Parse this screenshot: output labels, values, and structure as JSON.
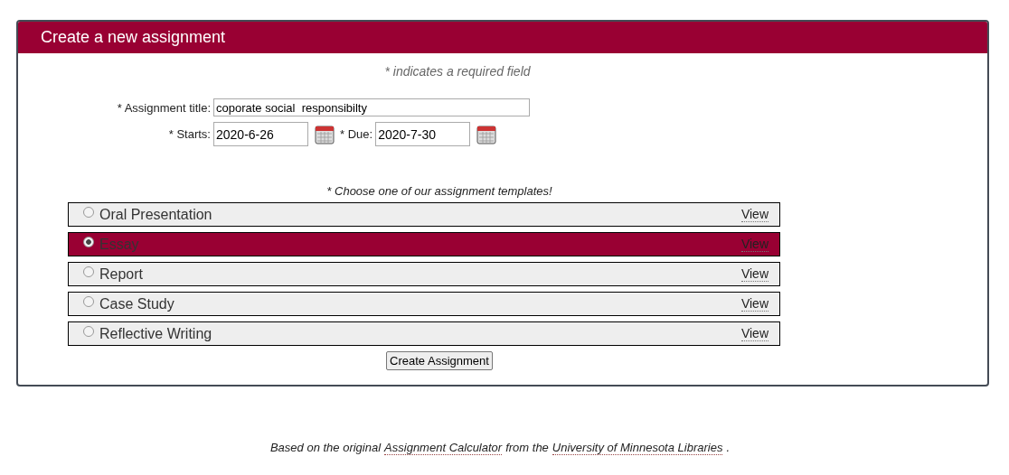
{
  "panel": {
    "title": "Create a new assignment",
    "required_note": "* indicates a required field",
    "fields": {
      "title_label": "* Assignment title:",
      "title_value": "coporate social  responsibilty",
      "starts_label": "* Starts:",
      "starts_value": "2020-6-26",
      "due_label": "* Due:",
      "due_value": "2020-7-30"
    },
    "templates_prompt": "* Choose one of our assignment templates!",
    "templates": [
      {
        "label": "Oral Presentation",
        "selected": false,
        "link": "View"
      },
      {
        "label": "Essay",
        "selected": true,
        "link": "View"
      },
      {
        "label": "Report",
        "selected": false,
        "link": "View"
      },
      {
        "label": "Case Study",
        "selected": false,
        "link": "View"
      },
      {
        "label": "Reflective Writing",
        "selected": false,
        "link": "View"
      }
    ],
    "submit": "Create Assignment"
  },
  "footer": {
    "prefix": "Based on the original",
    "link1": "Assignment Calculator",
    "middle": "from the",
    "link2": "University of Minnesota Libraries",
    "suffix": "."
  }
}
